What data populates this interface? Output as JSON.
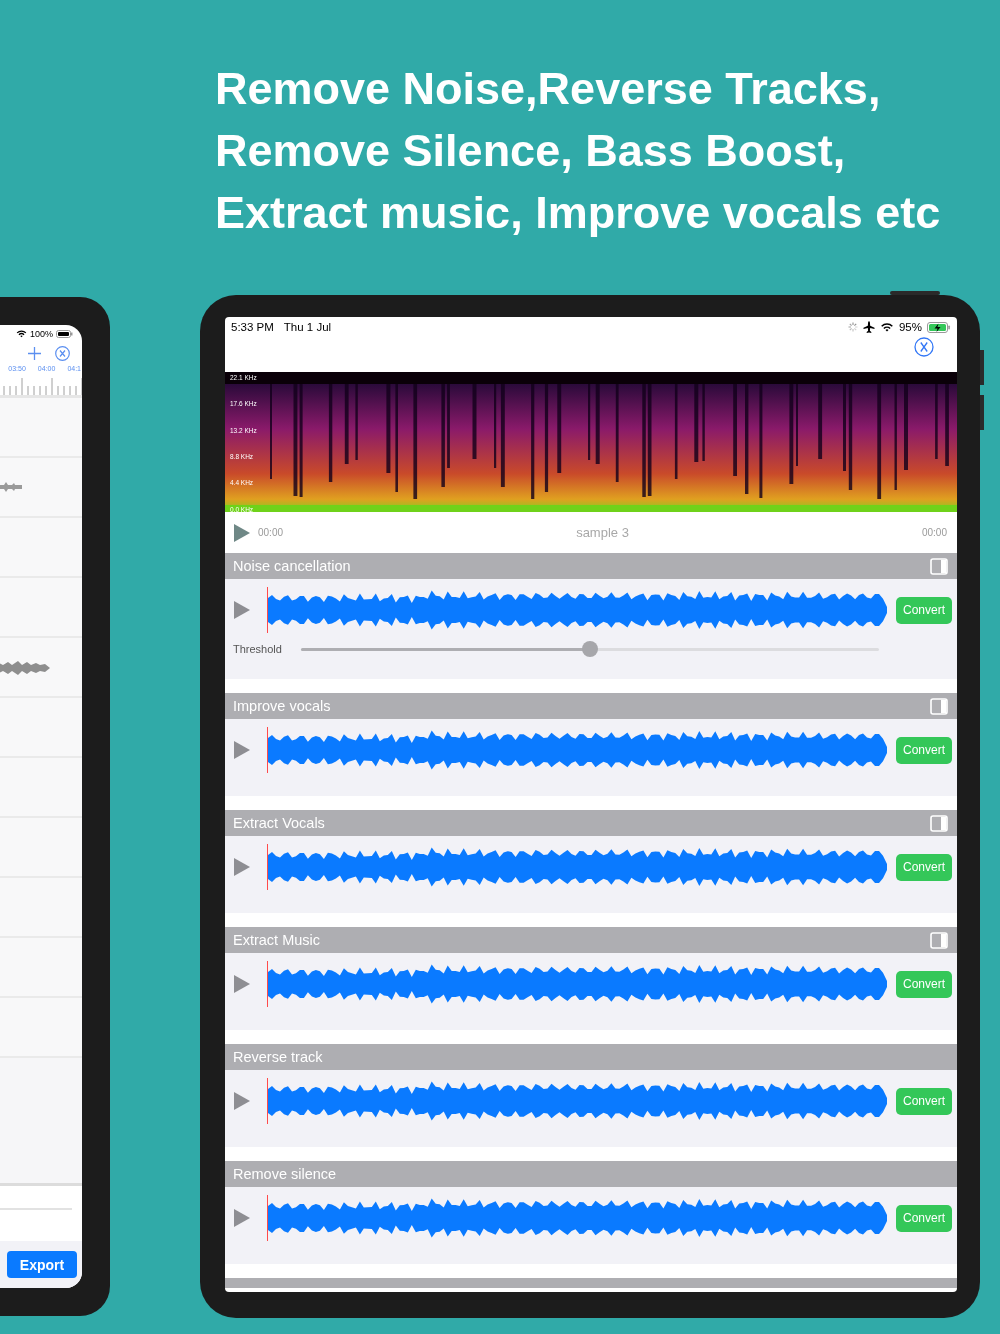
{
  "headline": [
    "Remove Noise,Reverse Tracks,",
    "Remove Silence, Bass Boost,",
    "Extract music, Improve vocals etc"
  ],
  "side_device": {
    "status_bar": {
      "battery": "100%"
    },
    "timeline_labels": [
      "03:50",
      "04:00",
      "04:1"
    ],
    "export_button": "Export"
  },
  "main_device": {
    "status_bar": {
      "time": "5:33 PM",
      "date": "Thu 1 Jul",
      "battery": "95%"
    },
    "spectrogram": {
      "frequency_labels": [
        "22.1 KHz",
        "17.6 KHz",
        "13.2 KHz",
        "8.8 KHz",
        "4.4 KHz",
        "0.0 KHz"
      ]
    },
    "player": {
      "elapsed": "00:00",
      "title": "sample 3",
      "duration": "00:00"
    },
    "effects": [
      {
        "title": "Noise cancellation",
        "checkbox": {
          "checked": false
        },
        "button": "Convert",
        "slider": {
          "label": "Threshold",
          "level": 0.5
        }
      },
      {
        "title": "Improve vocals",
        "checkbox": {
          "checked": false
        },
        "button": "Convert"
      },
      {
        "title": "Extract Vocals",
        "checkbox": {
          "checked": false
        },
        "button": "Convert"
      },
      {
        "title": "Extract Music",
        "checkbox": {
          "checked": false
        },
        "button": "Convert"
      },
      {
        "title": "Reverse track",
        "button": "Convert"
      },
      {
        "title": "Remove silence",
        "button": "Convert"
      }
    ]
  }
}
